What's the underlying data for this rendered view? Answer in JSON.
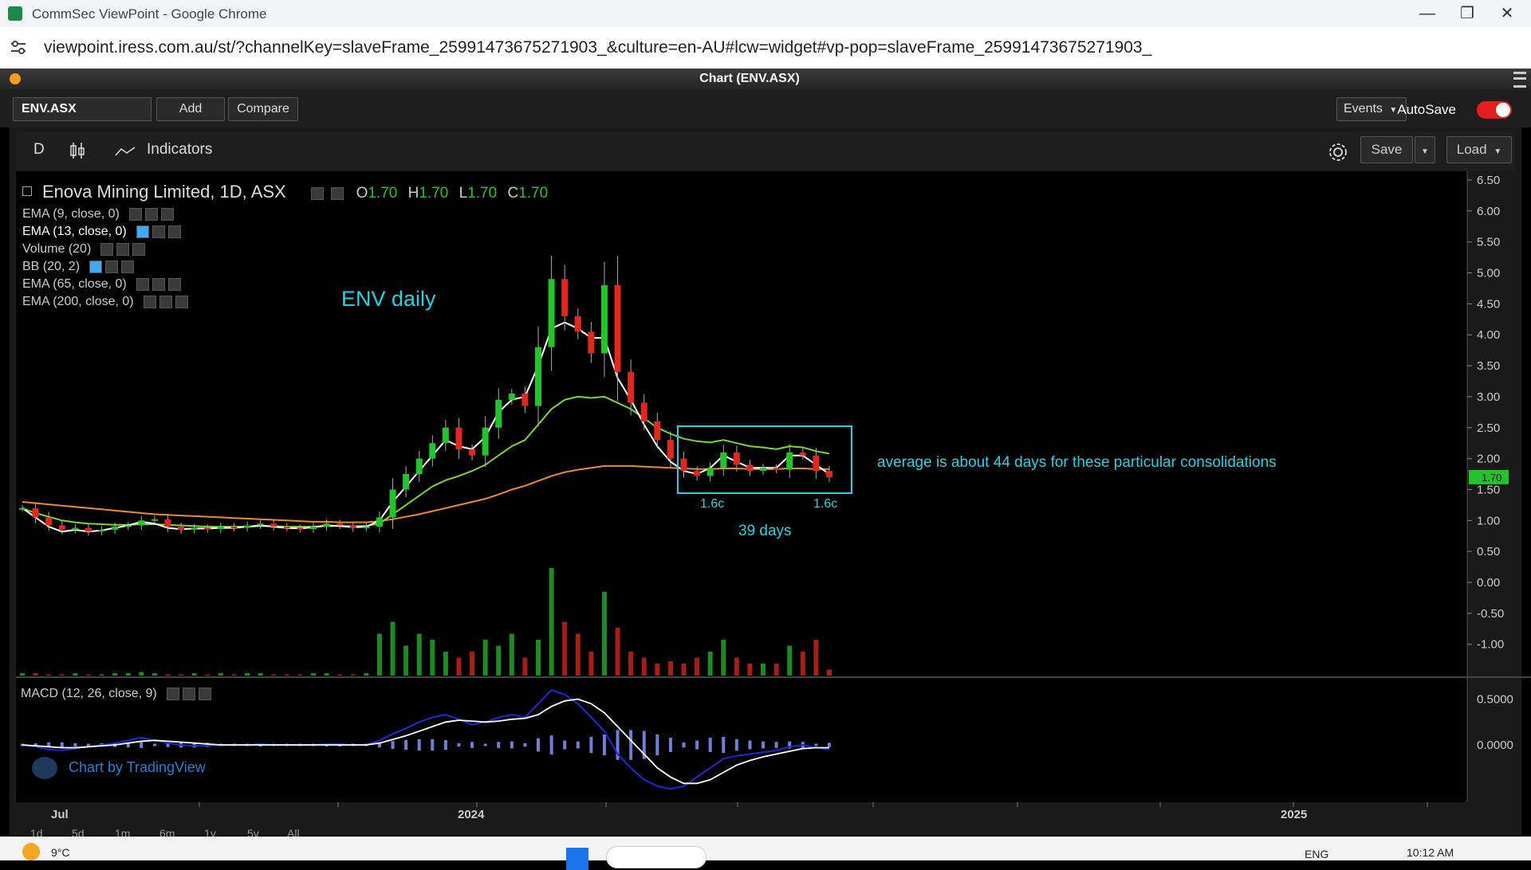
{
  "browser": {
    "window_title": "CommSec ViewPoint - Google Chrome",
    "url": "viewpoint.iress.com.au/st/?channelKey=slaveFrame_25991473675271903_&culture=en-AU#lcw=widget#vp-pop=slaveFrame_25991473675271903_"
  },
  "panel": {
    "title": "Chart (ENV.ASX)"
  },
  "toolbar": {
    "symbol": "ENV.ASX",
    "add_label": "Add",
    "compare_label": "Compare",
    "events_label": "Events",
    "autosave_label": "AutoSave"
  },
  "chart_toolbar": {
    "interval": "D",
    "indicators_label": "Indicators",
    "save_label": "Save",
    "load_label": "Load"
  },
  "legend": {
    "title": "Enova Mining Limited, 1D, ASX",
    "ohlc": {
      "o_label": "O",
      "o": "1.70",
      "h_label": "H",
      "h": "1.70",
      "l_label": "L",
      "l": "1.70",
      "c_label": "C",
      "c": "1.70"
    },
    "indicators": [
      "EMA (9, close, 0)",
      "EMA (13, close, 0)",
      "Volume (20)",
      "BB (20, 2)",
      "EMA (65, close, 0)",
      "EMA (200, close, 0)"
    ],
    "macd_label": "MACD (12, 26, close, 9)",
    "watermark": "Chart by TradingView"
  },
  "annotations": {
    "title": "ENV daily",
    "note": "average is about 44 days for these particular consolidations",
    "low_left": "1.6c",
    "low_right": "1.6c",
    "days": "39 days"
  },
  "colors": {
    "up": "#22c42a",
    "down": "#e0281e",
    "ema9": "#ffffff",
    "ema65": "#7ad92a",
    "ema200": "#f08a24",
    "annotation": "#1fd4e6",
    "macd": "#1a2ad8",
    "signal": "#ffffff",
    "price_tag": "#22c42a"
  },
  "chart_data": {
    "type": "candlestick",
    "price_axis_ticks": [
      "6.50",
      "6.00",
      "5.50",
      "5.00",
      "4.50",
      "4.00",
      "3.50",
      "3.00",
      "2.50",
      "2.00",
      "1.50",
      "1.00",
      "0.50",
      "0.00",
      "-0.50",
      "-1.00"
    ],
    "current_price_tag": "1.70",
    "macd_axis_ticks": [
      "0.5000",
      "0.0000"
    ],
    "x_labels": [
      "Jul",
      "2024",
      "2025"
    ],
    "range_buttons": [
      "1d",
      "5d",
      "1m",
      "6m",
      "1y",
      "5y",
      "All"
    ],
    "series": [
      {
        "key": "close",
        "values": [
          1.2,
          1.05,
          0.92,
          0.85,
          0.88,
          0.82,
          0.85,
          0.9,
          0.92,
          1.0,
          1.02,
          0.9,
          0.85,
          0.88,
          0.86,
          0.9,
          0.88,
          0.92,
          0.95,
          0.9,
          0.88,
          0.86,
          0.9,
          0.95,
          0.92,
          0.88,
          0.9,
          1.05,
          1.5,
          1.75,
          2.0,
          2.25,
          2.5,
          2.15,
          2.05,
          2.5,
          2.95,
          3.05,
          2.85,
          3.8,
          4.9,
          4.3,
          4.05,
          3.7,
          4.8,
          3.4,
          2.9,
          2.6,
          2.3,
          2.0,
          1.8,
          1.72,
          1.85,
          2.1,
          1.9,
          1.8,
          1.85,
          1.82,
          2.1,
          2.05,
          1.8,
          1.7
        ]
      },
      {
        "key": "ema9",
        "values": [
          1.2,
          1.05,
          0.9,
          0.82,
          0.85,
          0.82,
          0.84,
          0.88,
          0.92,
          0.98,
          0.95,
          0.88,
          0.86,
          0.87,
          0.87,
          0.88,
          0.88,
          0.9,
          0.92,
          0.9,
          0.88,
          0.87,
          0.89,
          0.92,
          0.91,
          0.89,
          0.9,
          1.0,
          1.3,
          1.55,
          1.8,
          2.05,
          2.3,
          2.2,
          2.15,
          2.35,
          2.75,
          2.95,
          3.0,
          3.5,
          4.1,
          4.2,
          4.1,
          3.95,
          3.95,
          3.3,
          2.95,
          2.55,
          2.2,
          1.95,
          1.8,
          1.75,
          1.85,
          2.05,
          1.95,
          1.85,
          1.85,
          1.85,
          2.05,
          2.05,
          1.9,
          1.75
        ]
      },
      {
        "key": "ema65",
        "values": [
          1.2,
          1.12,
          1.06,
          1.0,
          0.97,
          0.95,
          0.94,
          0.93,
          0.93,
          0.94,
          0.94,
          0.93,
          0.92,
          0.91,
          0.9,
          0.9,
          0.9,
          0.9,
          0.91,
          0.91,
          0.9,
          0.9,
          0.9,
          0.91,
          0.91,
          0.91,
          0.91,
          0.95,
          1.1,
          1.25,
          1.4,
          1.55,
          1.65,
          1.72,
          1.8,
          1.9,
          2.05,
          2.2,
          2.3,
          2.55,
          2.8,
          2.95,
          3.0,
          2.98,
          3.0,
          2.9,
          2.8,
          2.65,
          2.5,
          2.4,
          2.32,
          2.28,
          2.26,
          2.3,
          2.25,
          2.2,
          2.18,
          2.15,
          2.2,
          2.18,
          2.12,
          2.08
        ]
      },
      {
        "key": "ema200",
        "values": [
          1.3,
          1.28,
          1.26,
          1.24,
          1.22,
          1.2,
          1.18,
          1.16,
          1.14,
          1.12,
          1.1,
          1.09,
          1.08,
          1.07,
          1.06,
          1.05,
          1.04,
          1.03,
          1.02,
          1.01,
          1.0,
          0.99,
          0.98,
          0.98,
          0.97,
          0.97,
          0.97,
          0.99,
          1.02,
          1.06,
          1.1,
          1.15,
          1.2,
          1.25,
          1.3,
          1.35,
          1.42,
          1.5,
          1.56,
          1.64,
          1.72,
          1.78,
          1.82,
          1.85,
          1.88,
          1.88,
          1.88,
          1.87,
          1.86,
          1.85,
          1.84,
          1.83,
          1.83,
          1.84,
          1.84,
          1.83,
          1.83,
          1.83,
          1.84,
          1.84,
          1.83,
          1.83
        ]
      },
      {
        "key": "volume",
        "values": [
          0.02,
          0.02,
          0.01,
          0.01,
          0.02,
          0.01,
          0.01,
          0.02,
          0.02,
          0.03,
          0.02,
          0.01,
          0.01,
          0.02,
          0.01,
          0.02,
          0.01,
          0.02,
          0.02,
          0.01,
          0.01,
          0.01,
          0.02,
          0.02,
          0.01,
          0.01,
          0.02,
          0.35,
          0.45,
          0.25,
          0.35,
          0.3,
          0.2,
          0.15,
          0.2,
          0.3,
          0.25,
          0.35,
          0.15,
          0.3,
          0.9,
          0.45,
          0.35,
          0.2,
          0.7,
          0.4,
          0.2,
          0.15,
          0.1,
          0.12,
          0.1,
          0.15,
          0.2,
          0.3,
          0.15,
          0.1,
          0.1,
          0.1,
          0.25,
          0.2,
          0.3,
          0.05
        ]
      },
      {
        "key": "macd",
        "values": [
          0.0,
          -0.02,
          -0.05,
          -0.06,
          -0.04,
          -0.02,
          0.0,
          0.02,
          0.05,
          0.08,
          0.05,
          0.02,
          0.0,
          -0.01,
          -0.01,
          0.0,
          0.0,
          0.0,
          0.01,
          0.0,
          0.0,
          0.0,
          0.0,
          0.01,
          0.01,
          0.0,
          0.0,
          0.05,
          0.12,
          0.18,
          0.25,
          0.3,
          0.33,
          0.28,
          0.22,
          0.25,
          0.3,
          0.33,
          0.3,
          0.45,
          0.6,
          0.55,
          0.45,
          0.3,
          0.15,
          -0.1,
          -0.25,
          -0.38,
          -0.45,
          -0.48,
          -0.45,
          -0.35,
          -0.25,
          -0.15,
          -0.12,
          -0.1,
          -0.08,
          -0.06,
          -0.02,
          0.0,
          -0.03,
          -0.05
        ]
      },
      {
        "key": "signal",
        "values": [
          0.0,
          -0.01,
          -0.02,
          -0.03,
          -0.03,
          -0.02,
          -0.01,
          0.0,
          0.02,
          0.04,
          0.05,
          0.04,
          0.03,
          0.02,
          0.01,
          0.0,
          0.0,
          0.0,
          0.0,
          0.0,
          0.0,
          0.0,
          0.0,
          0.0,
          0.0,
          0.0,
          0.0,
          0.02,
          0.06,
          0.1,
          0.15,
          0.2,
          0.25,
          0.27,
          0.26,
          0.25,
          0.26,
          0.28,
          0.29,
          0.33,
          0.42,
          0.48,
          0.5,
          0.45,
          0.35,
          0.2,
          0.05,
          -0.1,
          -0.25,
          -0.35,
          -0.42,
          -0.42,
          -0.38,
          -0.3,
          -0.22,
          -0.17,
          -0.13,
          -0.1,
          -0.07,
          -0.04,
          -0.03,
          -0.03
        ]
      }
    ]
  }
}
